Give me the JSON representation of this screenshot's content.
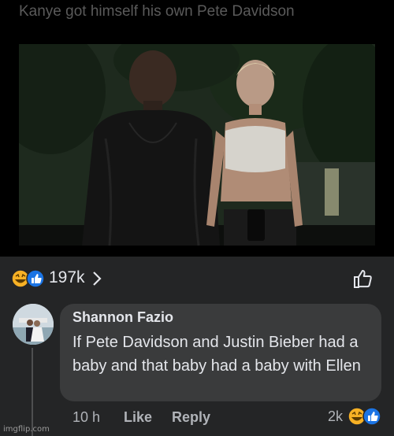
{
  "post": {
    "caption": "Kanye got himself his own Pete Davidson",
    "image_desc": "photo"
  },
  "reactions": {
    "count": "197k",
    "icons": [
      "laughing-face-icon",
      "like-badge-icon"
    ]
  },
  "comment": {
    "author": "Shannon Fazio",
    "text": "If Pete Davidson and Justin Bieber had a baby and that baby had a baby with Ellen",
    "time": "10 h",
    "like_label": "Like",
    "reply_label": "Reply",
    "reaction_count": "2k"
  },
  "watermark": "imgflip.com",
  "colors": {
    "background": "#242526",
    "bubble": "#3a3b3c",
    "like_blue": "#1b74e4",
    "haha_yellow": "#f7b125"
  }
}
